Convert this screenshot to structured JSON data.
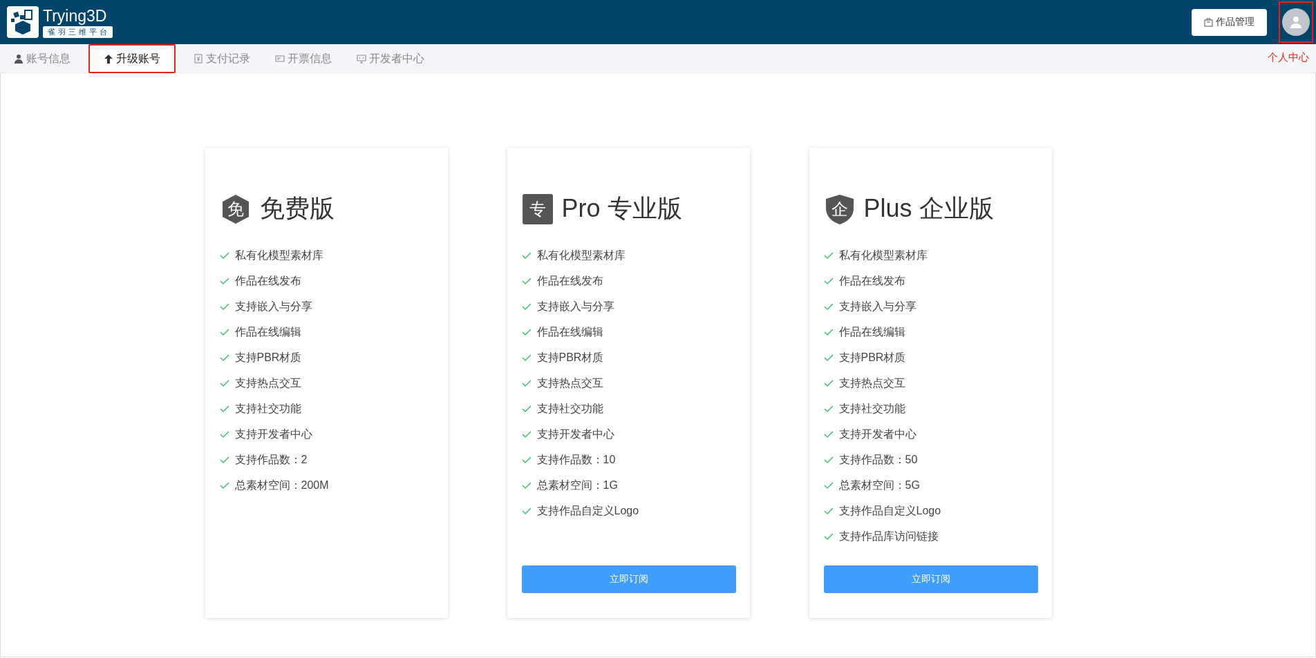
{
  "header": {
    "logo_title": "Trying3D",
    "logo_subtitle": "雀羽三维平台",
    "works_button": "作品管理",
    "user": {
      "highlighted": true,
      "annotation": "个人中心"
    }
  },
  "tabs": [
    {
      "label": "账号信息",
      "selected": false,
      "highlighted": false
    },
    {
      "label": "升级账号",
      "selected": true,
      "highlighted": true
    },
    {
      "label": "支付记录",
      "selected": false,
      "highlighted": false
    },
    {
      "label": "开票信息",
      "selected": false,
      "highlighted": false
    },
    {
      "label": "开发者中心",
      "selected": false,
      "highlighted": false
    }
  ],
  "plans": [
    {
      "badge": "免",
      "title": "免费版",
      "features": [
        "私有化模型素材库",
        "作品在线发布",
        "支持嵌入与分享",
        "作品在线编辑",
        "支持PBR材质",
        "支持热点交互",
        "支持社交功能",
        "支持开发者中心",
        "支持作品数：2",
        "总素材空间：200M"
      ]
    },
    {
      "badge": "专",
      "title": "Pro 专业版",
      "features": [
        "私有化模型素材库",
        "作品在线发布",
        "支持嵌入与分享",
        "作品在线编辑",
        "支持PBR材质",
        "支持热点交互",
        "支持社交功能",
        "支持开发者中心",
        "支持作品数：10",
        "总素材空间：1G",
        "支持作品自定义Logo"
      ],
      "button": "立即订阅"
    },
    {
      "badge": "企",
      "title": "Plus 企业版",
      "features": [
        "私有化模型素材库",
        "作品在线发布",
        "支持嵌入与分享",
        "作品在线编辑",
        "支持PBR材质",
        "支持热点交互",
        "支持社交功能",
        "支持开发者中心",
        "支持作品数：50",
        "总素材空间：5G",
        "支持作品自定义Logo",
        "支持作品库访问链接"
      ],
      "button": "立即订阅"
    }
  ]
}
